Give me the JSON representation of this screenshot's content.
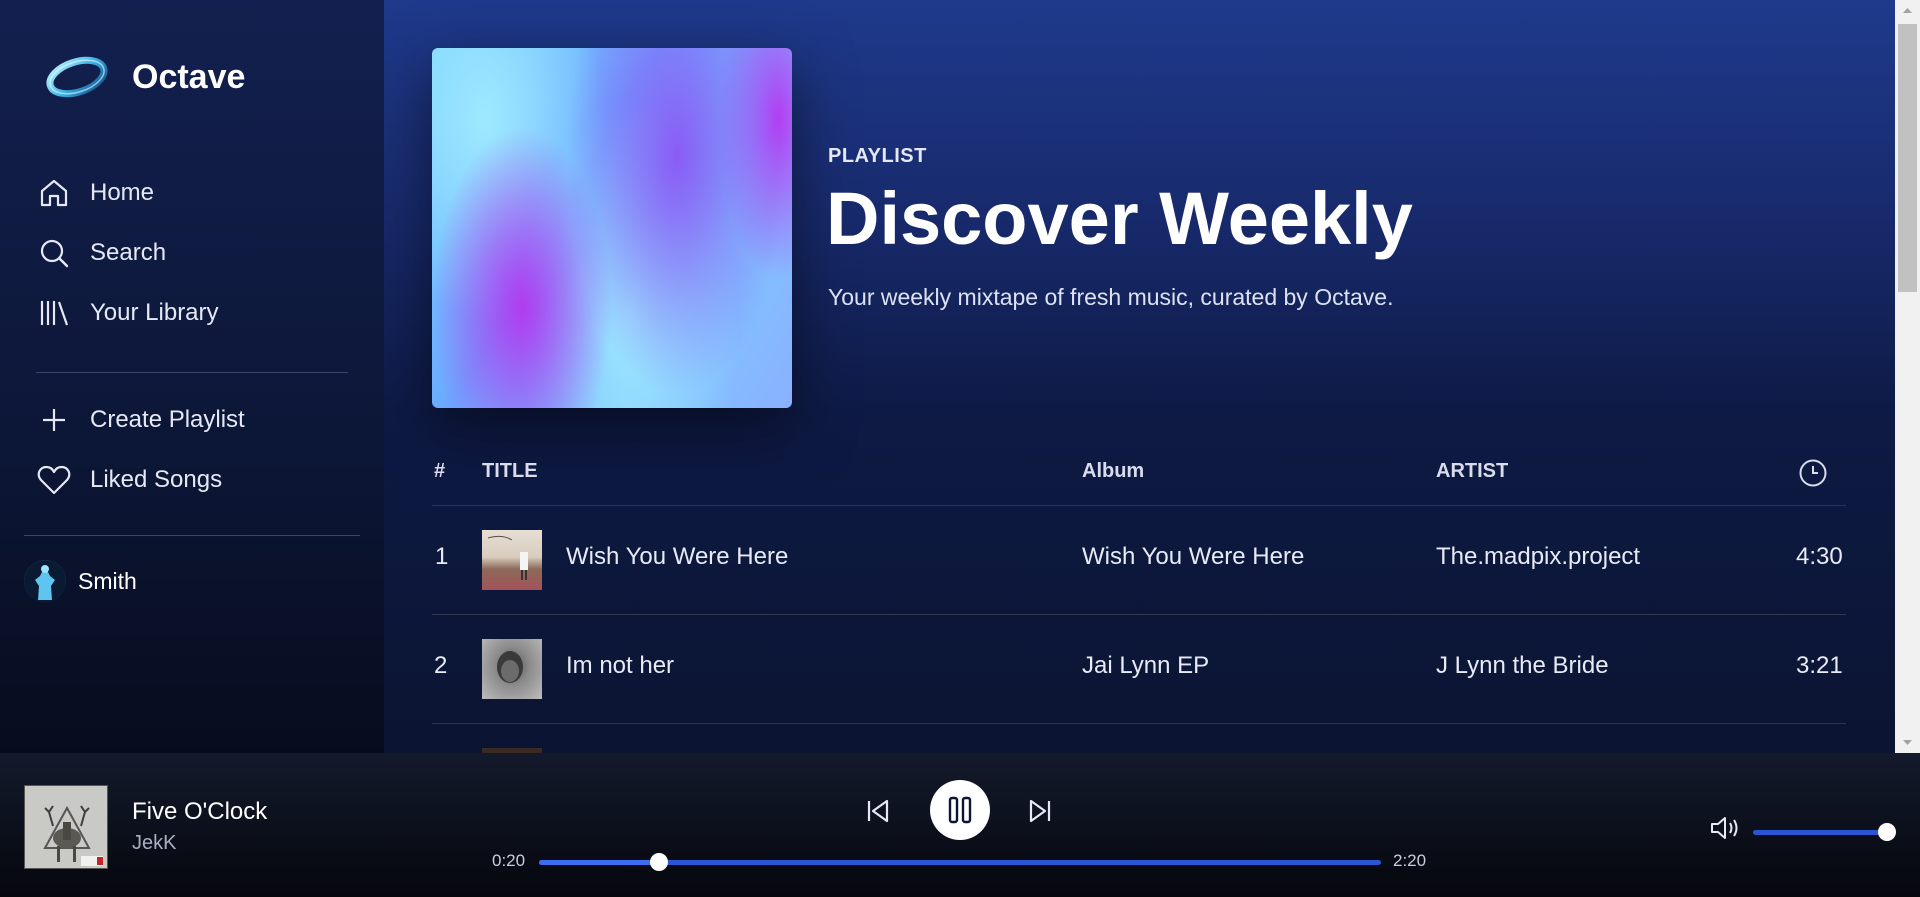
{
  "app": {
    "name": "Octave"
  },
  "sidebar": {
    "nav": [
      {
        "label": "Home",
        "icon": "home-icon"
      },
      {
        "label": "Search",
        "icon": "search-icon"
      },
      {
        "label": "Your Library",
        "icon": "library-icon"
      }
    ],
    "actions": [
      {
        "label": "Create Playlist",
        "icon": "plus-icon"
      },
      {
        "label": "Liked Songs",
        "icon": "heart-icon"
      }
    ],
    "user": {
      "name": "Smith"
    }
  },
  "playlist": {
    "type": "PLAYLIST",
    "title": "Discover Weekly",
    "description": "Your weekly mixtape of fresh music, curated by Octave."
  },
  "table": {
    "headers": {
      "number": "#",
      "title": "TITLE",
      "album": "Album",
      "artist": "ARTIST",
      "duration_icon": "clock-icon"
    },
    "rows": [
      {
        "number": "1",
        "title": "Wish You Were Here",
        "album": "Wish You Were Here",
        "artist": "The.madpix.project",
        "duration": "4:30"
      },
      {
        "number": "2",
        "title": "Im not her",
        "album": "Jai Lynn EP",
        "artist": "J Lynn the Bride",
        "duration": "3:21"
      }
    ]
  },
  "player": {
    "track": "Five O'Clock",
    "artist": "JekK",
    "elapsed": "0:20",
    "total": "2:20",
    "progress_fraction": 0.143,
    "volume_fraction": 1.0,
    "state": "playing"
  },
  "colors": {
    "accent": "#2a56d6",
    "background": "#0b1431"
  }
}
